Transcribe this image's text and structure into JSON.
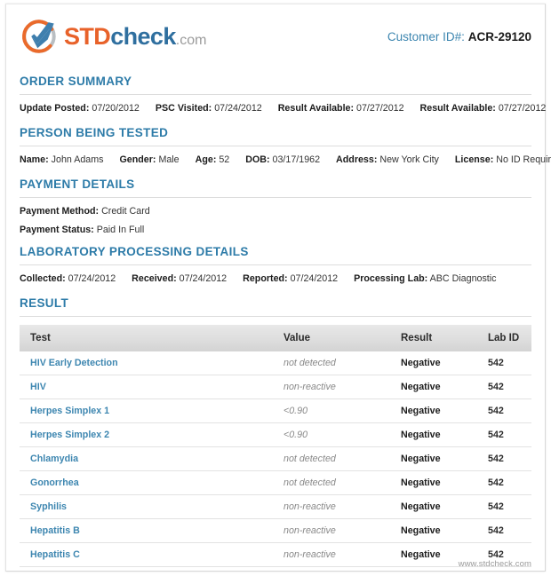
{
  "brand": {
    "logo_icon": "checkmark-shield-icon",
    "name_part1": "STD",
    "name_part2": "check",
    "name_tld": ".com",
    "colors": {
      "orange": "#e8622a",
      "blue": "#2f6f9f",
      "gray": "#9b9b9b",
      "heading_blue": "#2d7ba8",
      "link_blue": "#3d86b0"
    }
  },
  "header": {
    "customer_id_label": "Customer ID#:",
    "customer_id_value": "ACR-29120"
  },
  "order_summary": {
    "title": "ORDER SUMMARY",
    "fields": [
      {
        "label": "Update Posted:",
        "value": "07/20/2012"
      },
      {
        "label": "PSC Visited:",
        "value": "07/24/2012"
      },
      {
        "label": "Result Available:",
        "value": "07/27/2012"
      },
      {
        "label": "Result Available:",
        "value": "07/27/2012"
      }
    ]
  },
  "person_being_tested": {
    "title": "PERSON BEING TESTED",
    "fields": [
      {
        "label": "Name:",
        "value": "John Adams"
      },
      {
        "label": "Gender:",
        "value": "Male"
      },
      {
        "label": "Age:",
        "value": "52"
      },
      {
        "label": "DOB:",
        "value": "03/17/1962"
      },
      {
        "label": "Address:",
        "value": "New York City"
      },
      {
        "label": "License:",
        "value": "No ID Required"
      }
    ]
  },
  "payment_details": {
    "title": "PAYMENT DETAILS",
    "fields": [
      {
        "label": "Payment Method:",
        "value": "Credit Card"
      },
      {
        "label": "Payment Status:",
        "value": "Paid In Full"
      }
    ]
  },
  "laboratory_processing_details": {
    "title": "LABORATORY PROCESSING DETAILS",
    "fields": [
      {
        "label": "Collected:",
        "value": "07/24/2012"
      },
      {
        "label": "Received:",
        "value": "07/24/2012"
      },
      {
        "label": "Reported:",
        "value": "07/24/2012"
      },
      {
        "label": "Processing Lab:",
        "value": "ABC Diagnostic"
      }
    ]
  },
  "result": {
    "title": "RESULT",
    "columns": [
      "Test",
      "Value",
      "Result",
      "Lab ID"
    ],
    "rows": [
      {
        "test": "HIV Early Detection",
        "value": "not detected",
        "result": "Negative",
        "lab_id": "542"
      },
      {
        "test": "HIV",
        "value": "non-reactive",
        "result": "Negative",
        "lab_id": "542"
      },
      {
        "test": "Herpes Simplex 1",
        "value": "<0.90",
        "result": "Negative",
        "lab_id": "542"
      },
      {
        "test": "Herpes Simplex 2",
        "value": "<0.90",
        "result": "Negative",
        "lab_id": "542"
      },
      {
        "test": "Chlamydia",
        "value": "not detected",
        "result": "Negative",
        "lab_id": "542"
      },
      {
        "test": "Gonorrhea",
        "value": "not detected",
        "result": "Negative",
        "lab_id": "542"
      },
      {
        "test": "Syphilis",
        "value": "non-reactive",
        "result": "Negative",
        "lab_id": "542"
      },
      {
        "test": "Hepatitis B",
        "value": "non-reactive",
        "result": "Negative",
        "lab_id": "542"
      },
      {
        "test": "Hepatitis C",
        "value": "non-reactive",
        "result": "Negative",
        "lab_id": "542"
      }
    ]
  },
  "footer": {
    "website": "www.stdcheck.com"
  }
}
